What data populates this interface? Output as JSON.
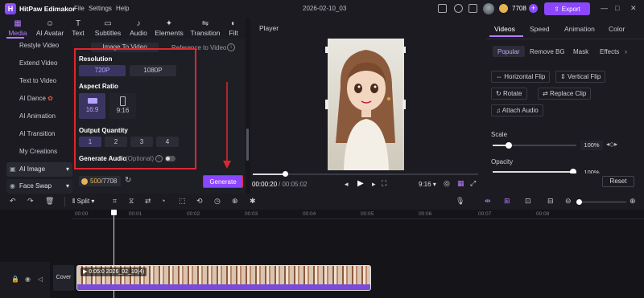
{
  "app": {
    "name": "HitPaw Edimakor",
    "project": "2026-02-10_03",
    "credits": "7708",
    "export_label": "Export"
  },
  "menu": [
    "File",
    "Settings",
    "Help"
  ],
  "toolbar": [
    "Media",
    "AI Avatar",
    "Text",
    "Subtitles",
    "Audio",
    "Elements",
    "Transition",
    "Filt"
  ],
  "left_nav": [
    "Restyle Video",
    "Extend Video",
    "Text to Video",
    "AI Dance",
    "AI Animation",
    "AI Transition",
    "My Creations",
    "AI Image",
    "Face Swap"
  ],
  "gen_panel": {
    "mode_tabs": [
      "Image To Video",
      "Reference to Video"
    ],
    "resolution_label": "Resolution",
    "resolutions": [
      "720P",
      "1080P"
    ],
    "aspect_label": "Aspect Ratio",
    "aspects": [
      "16:9",
      "9:16"
    ],
    "quantity_label": "Output Quantity",
    "quantities": [
      "1",
      "2",
      "3",
      "4"
    ],
    "audio_label": "Generate Audio",
    "audio_optional": "(Optional)",
    "credit_used": "500",
    "credit_total": "/7708",
    "generate_label": "Generate"
  },
  "player": {
    "title": "Player",
    "time_current": "00:00:20",
    "time_total": "/ 00:05:02",
    "ratio": "9:16"
  },
  "right_panel": {
    "tabs": [
      "Videos",
      "Speed",
      "Animation",
      "Color"
    ],
    "subtabs": [
      "Popular",
      "Remove BG",
      "Mask",
      "Effects"
    ],
    "actions": [
      "Horizontal Flip",
      "Vertical Flip",
      "Rotate",
      "Replace Clip",
      "Attach Audio"
    ],
    "scale_label": "Scale",
    "scale_value": "100%",
    "opacity_label": "Opacity",
    "opacity_value": "100%",
    "reset_label": "Reset"
  },
  "timeline": {
    "split_label": "Split",
    "ruler": [
      "00:00",
      "00:01",
      "00:02",
      "00:03",
      "00:04",
      "00:05",
      "00:06",
      "00:07",
      "00:08"
    ],
    "cover_label": "Cover",
    "clip_label": "0:05:0",
    "clip_name": "2026_02_10(4)"
  }
}
